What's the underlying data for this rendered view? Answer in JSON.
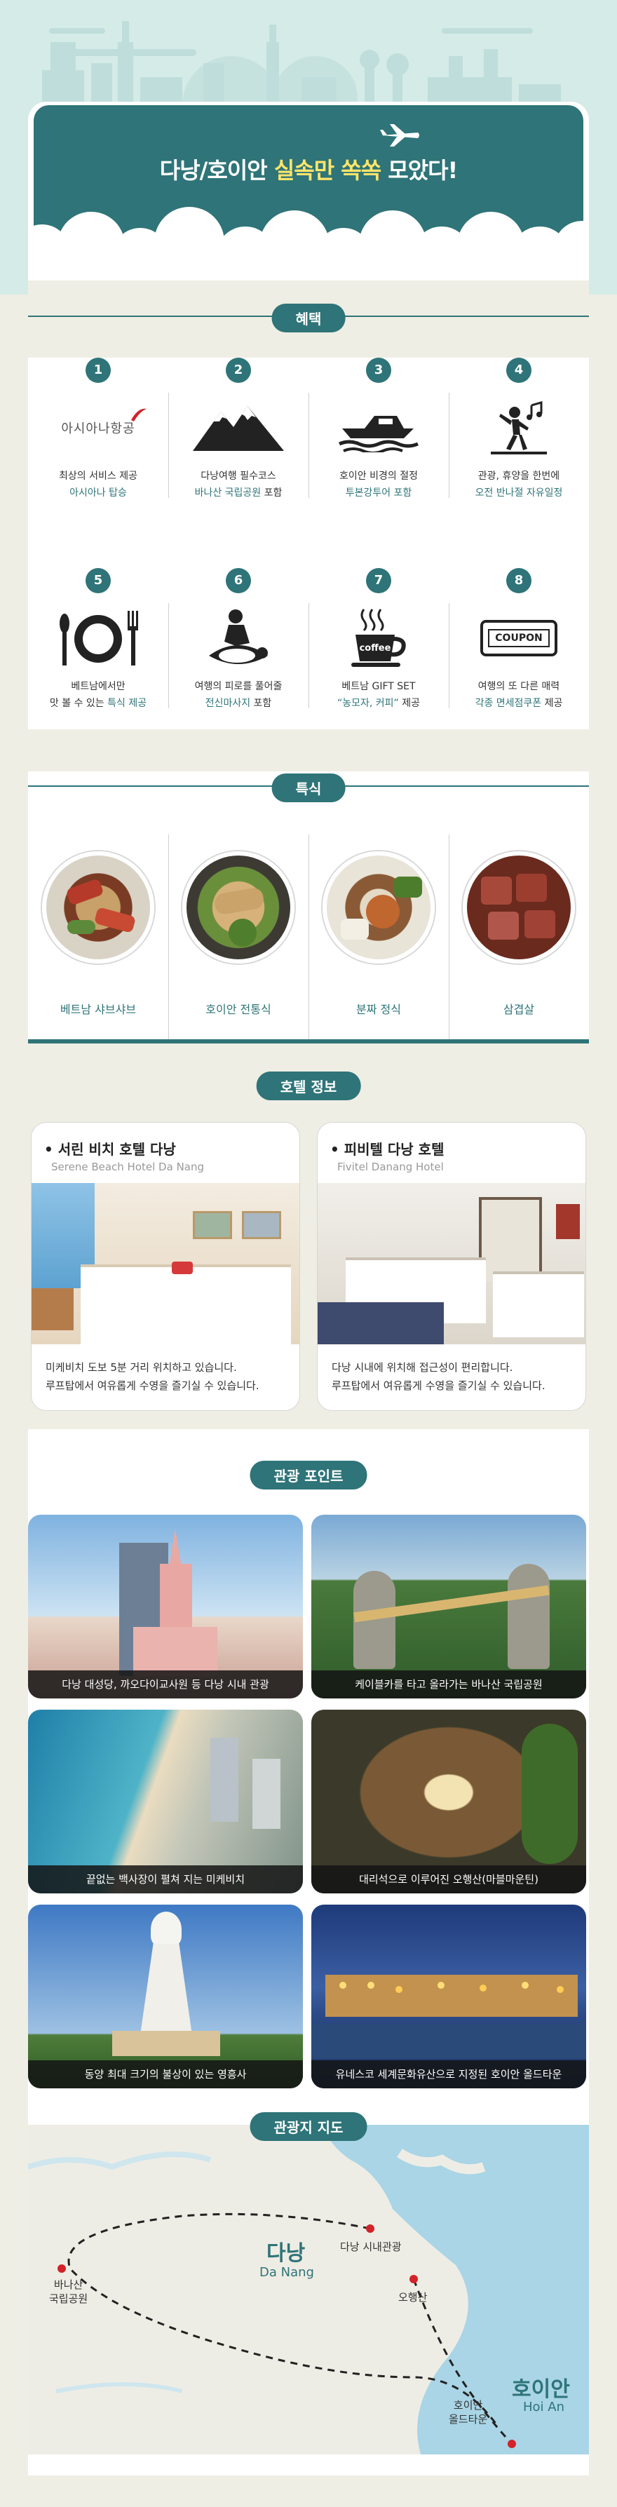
{
  "hero": {
    "title_a": "다낭/호이안 ",
    "title_hl": "실속만 쏙쏙",
    "title_b": " 모았다!"
  },
  "sections": {
    "benefits": "혜택",
    "foods": "특식",
    "hotels": "호텔 정보",
    "tour": "관광 포인트",
    "map": "관광지 지도"
  },
  "benefits": [
    {
      "num": "1",
      "icon": "asiana-logo",
      "logo_text": "아시아나항공",
      "line1": "최상의 서비스 제공",
      "line2": "아시아나 탑승",
      "line2_rest": ""
    },
    {
      "num": "2",
      "icon": "mountain-icon",
      "line1": "다낭여행 필수코스",
      "line2": "바나산 국립공원",
      "line2_rest": " 포함"
    },
    {
      "num": "3",
      "icon": "speedboat-icon",
      "line1": "호이안 비경의 절정",
      "line2": "투본강투어 포함",
      "line2_rest": ""
    },
    {
      "num": "4",
      "icon": "dancing-person-icon",
      "line1": "관광, 휴양을 한번에",
      "line2": "오전 반나절 자유일정",
      "line2_rest": ""
    },
    {
      "num": "5",
      "icon": "dining-plate-icon",
      "line1": "베트남에서만",
      "line2a": "맛 볼 수 있는 ",
      "line2": "특식 제공",
      "line2_rest": ""
    },
    {
      "num": "6",
      "icon": "massage-icon",
      "line1": "여행의 피로를 풀어줄",
      "line2": "전신마사지",
      "line2_rest": " 포함"
    },
    {
      "num": "7",
      "icon": "coffee-cup-icon",
      "coffee_text": "coffee",
      "line1": "베트남 GIFT SET",
      "line2": "“농모자, 커피”",
      "line2_rest": " 제공"
    },
    {
      "num": "8",
      "icon": "coupon-icon",
      "coupon_text": "COUPON",
      "line1": "여행의 또 다른 매력",
      "line2": "각종 면세점쿠폰",
      "line2_rest": " 제공"
    }
  ],
  "foods": [
    {
      "name": "베트남 샤브샤브"
    },
    {
      "name": "호이안 전통식"
    },
    {
      "name": "분짜 정식"
    },
    {
      "name": "삼겹살"
    }
  ],
  "hotels": [
    {
      "name": "• 서린 비치 호텔 다낭",
      "sub": "Serene Beach Hotel Da Nang",
      "desc1": "미케비치 도보 5분 거리 위치하고 있습니다.",
      "desc2": "루프탑에서 여유롭게 수영을 즐기실 수 있습니다."
    },
    {
      "name": "• 피비텔 다낭 호텔",
      "sub": "Fivitel Danang Hotel",
      "desc1": "다낭 시내에 위치해 접근성이 편리합니다.",
      "desc2": "루프탑에서 여유롭게 수영을 즐기실 수 있습니다."
    }
  ],
  "tours": [
    {
      "caption": "다낭 대성당, 까오다이교사원 등 다낭 시내 관광"
    },
    {
      "caption": "케이블카를 타고 올라가는 바나산 국립공원"
    },
    {
      "caption": "끝없는 백사장이 펼쳐 지는 미케비치"
    },
    {
      "caption": "대리석으로 이루어진 오행산(마블마운틴)"
    },
    {
      "caption": "동양 최대 크기의 불상이 있는 영흥사"
    },
    {
      "caption": "유네스코 세계문화유산으로 지정된 호이안 올드타운"
    }
  ],
  "map": {
    "danang_ko": "다낭",
    "danang_en": "Da Nang",
    "hoian_ko": "호이안",
    "hoian_en": "Hoi An",
    "spot_city": "다낭 시내관광",
    "spot_bana_1": "바나산",
    "spot_bana_2": "국립공원",
    "spot_marble": "오행산",
    "spot_oldtown_1": "호이안",
    "spot_oldtown_2": "올드타운"
  },
  "colors": {
    "primary": "#2e7478",
    "accent": "#ffe56a",
    "background": "#efeee4",
    "pin": "#d2232a"
  }
}
